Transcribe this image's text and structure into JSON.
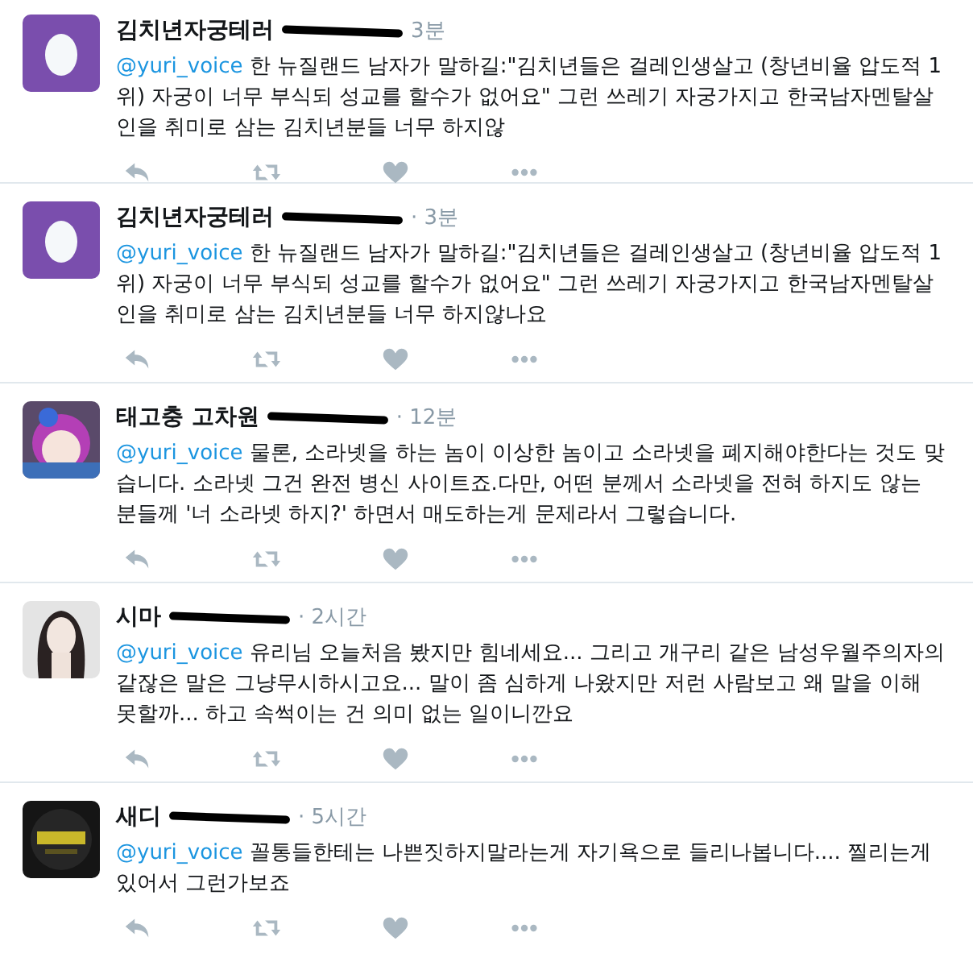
{
  "tweets": [
    {
      "kind": "egg",
      "name": "김치년자궁테러",
      "time": "3분",
      "mention": "@yuri_voice",
      "body": " 한 뉴질랜드 남자가 말하길:\"김치년들은 걸레인생살고 (창년비율 압도적 1위) 자궁이 너무 부식되 성교를 할수가 없어요\" 그런 쓰레기 자궁가지고 한국남자멘탈살인을 취미로 삼는 김치년분들 너무 하지않"
    },
    {
      "kind": "egg",
      "name": "김치년자궁테러",
      "time": "· 3분",
      "mention": "@yuri_voice",
      "body": " 한 뉴질랜드 남자가 말하길:\"김치년들은 걸레인생살고 (창년비율 압도적 1위) 자궁이 너무 부식되 성교를 할수가 없어요\" 그런 쓰레기 자궁가지고 한국남자멘탈살인을 취미로 삼는 김치년분들 너무 하지않나요"
    },
    {
      "kind": "picture",
      "name": "태고충 고차원",
      "time": "· 12분",
      "mention": "@yuri_voice",
      "body": " 물론, 소라넷을 하는 놈이 이상한 놈이고 소라넷을 폐지해야한다는 것도 맞습니다. 소라넷 그건 완전 병신 사이트죠.다만, 어떤 분께서 소라넷을 전혀 하지도 않는 분들께 '너 소라넷 하지?' 하면서 매도하는게 문제라서 그렇습니다."
    },
    {
      "kind": "picture",
      "name": "시마",
      "time": "· 2시간",
      "mention": "@yuri_voice",
      "body": " 유리님 오늘처음 봤지만 힘네세요... 그리고 개구리 같은 남성우월주의자의 같잖은 말은 그냥무시하시고요... 말이 좀 심하게 나왔지만 저런 사람보고 왜 말을 이해 못할까... 하고 속썩이는 건 의미 없는 일이니깐요"
    },
    {
      "kind": "picture",
      "name": "새디",
      "time": "· 5시간",
      "mention": "@yuri_voice",
      "body": " 꼴통들한테는 나쁜짓하지말라는게 자기욕으로 들리나봅니다.... 찔리는게 있어서 그런가보죠"
    }
  ]
}
